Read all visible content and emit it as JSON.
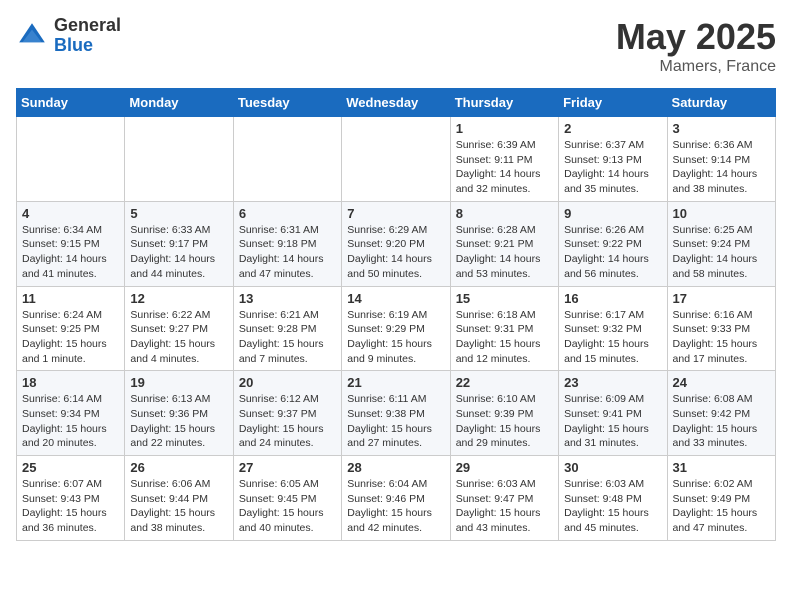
{
  "logo": {
    "general": "General",
    "blue": "Blue"
  },
  "title": {
    "month": "May 2025",
    "location": "Mamers, France"
  },
  "headers": [
    "Sunday",
    "Monday",
    "Tuesday",
    "Wednesday",
    "Thursday",
    "Friday",
    "Saturday"
  ],
  "weeks": [
    [
      {
        "num": "",
        "info": ""
      },
      {
        "num": "",
        "info": ""
      },
      {
        "num": "",
        "info": ""
      },
      {
        "num": "",
        "info": ""
      },
      {
        "num": "1",
        "info": "Sunrise: 6:39 AM\nSunset: 9:11 PM\nDaylight: 14 hours\nand 32 minutes."
      },
      {
        "num": "2",
        "info": "Sunrise: 6:37 AM\nSunset: 9:13 PM\nDaylight: 14 hours\nand 35 minutes."
      },
      {
        "num": "3",
        "info": "Sunrise: 6:36 AM\nSunset: 9:14 PM\nDaylight: 14 hours\nand 38 minutes."
      }
    ],
    [
      {
        "num": "4",
        "info": "Sunrise: 6:34 AM\nSunset: 9:15 PM\nDaylight: 14 hours\nand 41 minutes."
      },
      {
        "num": "5",
        "info": "Sunrise: 6:33 AM\nSunset: 9:17 PM\nDaylight: 14 hours\nand 44 minutes."
      },
      {
        "num": "6",
        "info": "Sunrise: 6:31 AM\nSunset: 9:18 PM\nDaylight: 14 hours\nand 47 minutes."
      },
      {
        "num": "7",
        "info": "Sunrise: 6:29 AM\nSunset: 9:20 PM\nDaylight: 14 hours\nand 50 minutes."
      },
      {
        "num": "8",
        "info": "Sunrise: 6:28 AM\nSunset: 9:21 PM\nDaylight: 14 hours\nand 53 minutes."
      },
      {
        "num": "9",
        "info": "Sunrise: 6:26 AM\nSunset: 9:22 PM\nDaylight: 14 hours\nand 56 minutes."
      },
      {
        "num": "10",
        "info": "Sunrise: 6:25 AM\nSunset: 9:24 PM\nDaylight: 14 hours\nand 58 minutes."
      }
    ],
    [
      {
        "num": "11",
        "info": "Sunrise: 6:24 AM\nSunset: 9:25 PM\nDaylight: 15 hours\nand 1 minute."
      },
      {
        "num": "12",
        "info": "Sunrise: 6:22 AM\nSunset: 9:27 PM\nDaylight: 15 hours\nand 4 minutes."
      },
      {
        "num": "13",
        "info": "Sunrise: 6:21 AM\nSunset: 9:28 PM\nDaylight: 15 hours\nand 7 minutes."
      },
      {
        "num": "14",
        "info": "Sunrise: 6:19 AM\nSunset: 9:29 PM\nDaylight: 15 hours\nand 9 minutes."
      },
      {
        "num": "15",
        "info": "Sunrise: 6:18 AM\nSunset: 9:31 PM\nDaylight: 15 hours\nand 12 minutes."
      },
      {
        "num": "16",
        "info": "Sunrise: 6:17 AM\nSunset: 9:32 PM\nDaylight: 15 hours\nand 15 minutes."
      },
      {
        "num": "17",
        "info": "Sunrise: 6:16 AM\nSunset: 9:33 PM\nDaylight: 15 hours\nand 17 minutes."
      }
    ],
    [
      {
        "num": "18",
        "info": "Sunrise: 6:14 AM\nSunset: 9:34 PM\nDaylight: 15 hours\nand 20 minutes."
      },
      {
        "num": "19",
        "info": "Sunrise: 6:13 AM\nSunset: 9:36 PM\nDaylight: 15 hours\nand 22 minutes."
      },
      {
        "num": "20",
        "info": "Sunrise: 6:12 AM\nSunset: 9:37 PM\nDaylight: 15 hours\nand 24 minutes."
      },
      {
        "num": "21",
        "info": "Sunrise: 6:11 AM\nSunset: 9:38 PM\nDaylight: 15 hours\nand 27 minutes."
      },
      {
        "num": "22",
        "info": "Sunrise: 6:10 AM\nSunset: 9:39 PM\nDaylight: 15 hours\nand 29 minutes."
      },
      {
        "num": "23",
        "info": "Sunrise: 6:09 AM\nSunset: 9:41 PM\nDaylight: 15 hours\nand 31 minutes."
      },
      {
        "num": "24",
        "info": "Sunrise: 6:08 AM\nSunset: 9:42 PM\nDaylight: 15 hours\nand 33 minutes."
      }
    ],
    [
      {
        "num": "25",
        "info": "Sunrise: 6:07 AM\nSunset: 9:43 PM\nDaylight: 15 hours\nand 36 minutes."
      },
      {
        "num": "26",
        "info": "Sunrise: 6:06 AM\nSunset: 9:44 PM\nDaylight: 15 hours\nand 38 minutes."
      },
      {
        "num": "27",
        "info": "Sunrise: 6:05 AM\nSunset: 9:45 PM\nDaylight: 15 hours\nand 40 minutes."
      },
      {
        "num": "28",
        "info": "Sunrise: 6:04 AM\nSunset: 9:46 PM\nDaylight: 15 hours\nand 42 minutes."
      },
      {
        "num": "29",
        "info": "Sunrise: 6:03 AM\nSunset: 9:47 PM\nDaylight: 15 hours\nand 43 minutes."
      },
      {
        "num": "30",
        "info": "Sunrise: 6:03 AM\nSunset: 9:48 PM\nDaylight: 15 hours\nand 45 minutes."
      },
      {
        "num": "31",
        "info": "Sunrise: 6:02 AM\nSunset: 9:49 PM\nDaylight: 15 hours\nand 47 minutes."
      }
    ]
  ]
}
